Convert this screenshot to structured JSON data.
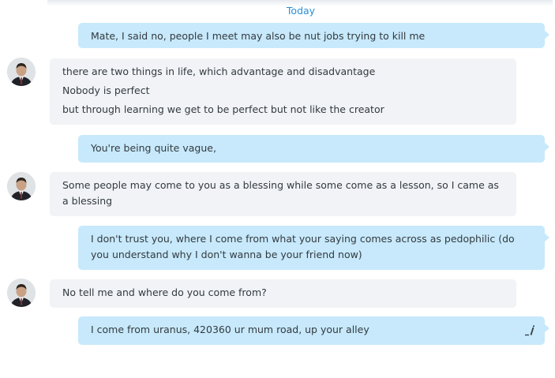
{
  "conversation": {
    "date_separator": "Today",
    "messages": [
      {
        "direction": "outgoing",
        "lines": [
          "Mate, I said no, people I meet may also be nut jobs trying to kill me"
        ]
      },
      {
        "direction": "incoming",
        "lines": [
          "there are two things in life, which advantage and disadvantage",
          "Nobody is perfect",
          "but through learning we get to be perfect but not like the creator"
        ]
      },
      {
        "direction": "outgoing",
        "lines": [
          "You're being quite vague,"
        ]
      },
      {
        "direction": "incoming",
        "lines": [
          "Some people may come to you as a blessing while some come as a lesson, so I came as a blessing"
        ]
      },
      {
        "direction": "outgoing",
        "lines": [
          "I don't trust you, where I come from what your saying comes across as pedophilic (do you understand why I don't wanna be your friend now)"
        ]
      },
      {
        "direction": "incoming",
        "lines": [
          "No tell me and where do you come from?"
        ]
      },
      {
        "direction": "outgoing",
        "lines": [
          "I come from uranus, 420360 ur mum road, up your alley"
        ],
        "edited_icon": "edit-pencil-icon"
      }
    ]
  },
  "colors": {
    "outgoing_bubble": "#c7e9fb",
    "incoming_bubble": "#f1f3f6",
    "date_separator": "#2a8fd6",
    "text": "#333a40"
  }
}
